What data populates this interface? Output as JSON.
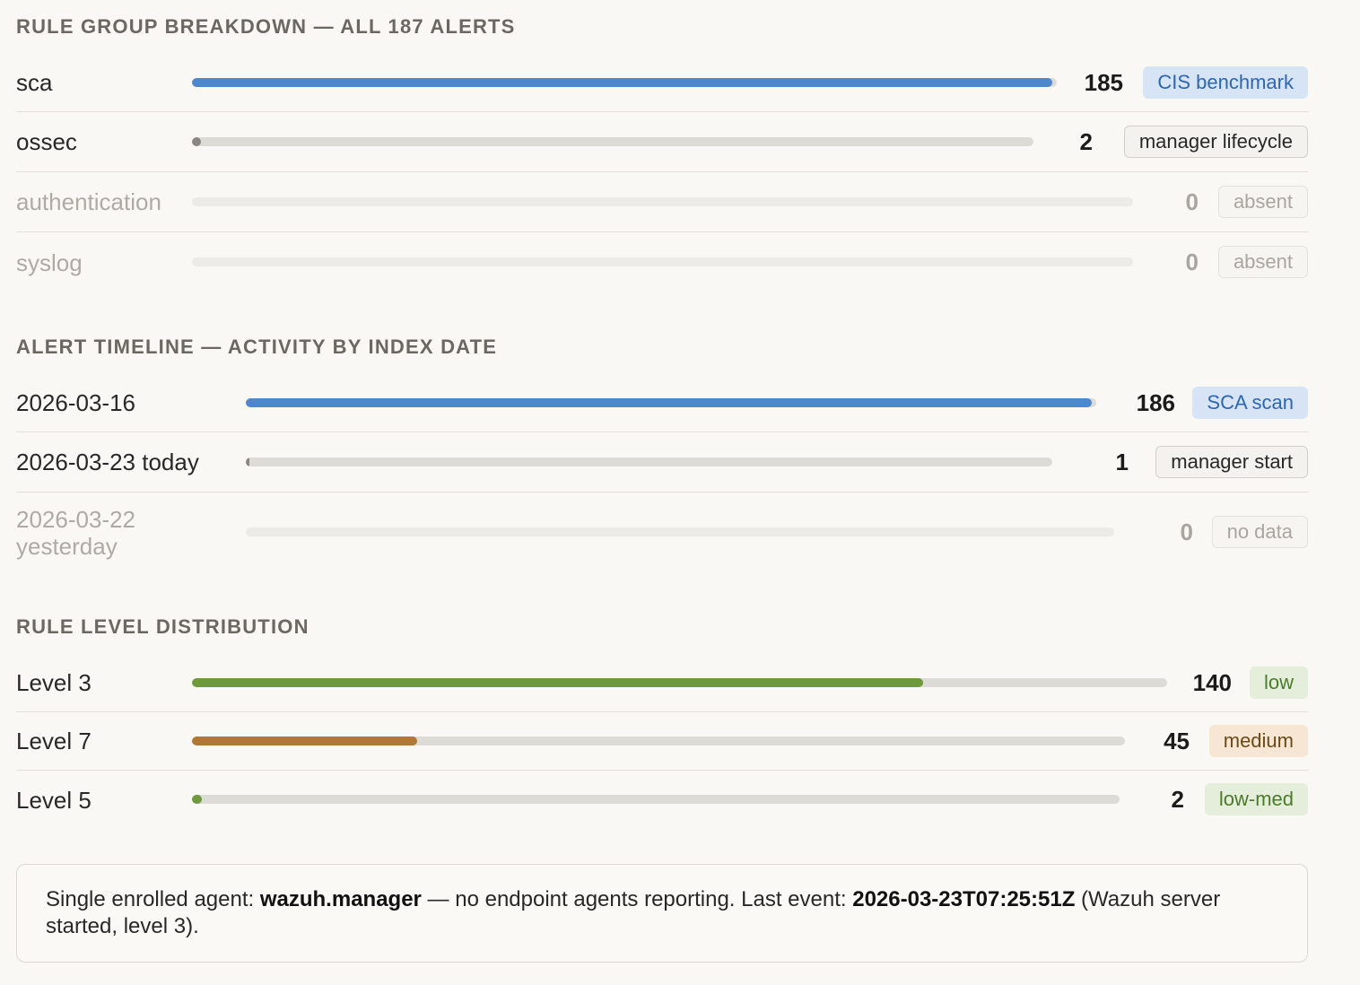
{
  "rule_groups": {
    "title": "RULE GROUP BREAKDOWN — ALL 187 ALERTS",
    "rows": [
      {
        "label": "sca",
        "count": "185",
        "tag": "CIS benchmark",
        "fraction": 0.995,
        "color": "#4f87cc"
      },
      {
        "label": "ossec",
        "count": "2",
        "tag": "manager lifecycle",
        "fraction": 0.011,
        "color": "#8a8782"
      },
      {
        "label": "authentication",
        "count": "0",
        "tag": "absent",
        "fraction": 0
      },
      {
        "label": "syslog",
        "count": "0",
        "tag": "absent",
        "fraction": 0
      }
    ]
  },
  "timeline": {
    "title": "ALERT TIMELINE — ACTIVITY BY INDEX DATE",
    "rows": [
      {
        "label": "2026-03-16",
        "count": "186",
        "tag": "SCA scan",
        "fraction": 0.995,
        "color": "#4f87cc"
      },
      {
        "label": "2026-03-23 today",
        "count": "1",
        "tag": "manager start",
        "fraction": 0.005,
        "color": "#8a8782"
      },
      {
        "label": "2026-03-22 yesterday",
        "count": "0",
        "tag": "no data",
        "fraction": 0
      }
    ]
  },
  "levels": {
    "title": "RULE LEVEL DISTRIBUTION",
    "rows": [
      {
        "label": "Level 3",
        "count": "140",
        "tag": "low",
        "fraction": 0.75,
        "color": "#6e9a3c"
      },
      {
        "label": "Level 7",
        "count": "45",
        "tag": "medium",
        "fraction": 0.241,
        "color": "#b07834"
      },
      {
        "label": "Level 5",
        "count": "2",
        "tag": "low-med",
        "fraction": 0.011,
        "color": "#6e9a3c"
      }
    ]
  },
  "footer": {
    "prefix": "Single enrolled agent: ",
    "agent": "wazuh.manager",
    "middle": " — no endpoint agents reporting. Last event: ",
    "timestamp": "2026-03-23T07:25:51Z",
    "suffix": " (Wazuh server started, level 3)."
  }
}
